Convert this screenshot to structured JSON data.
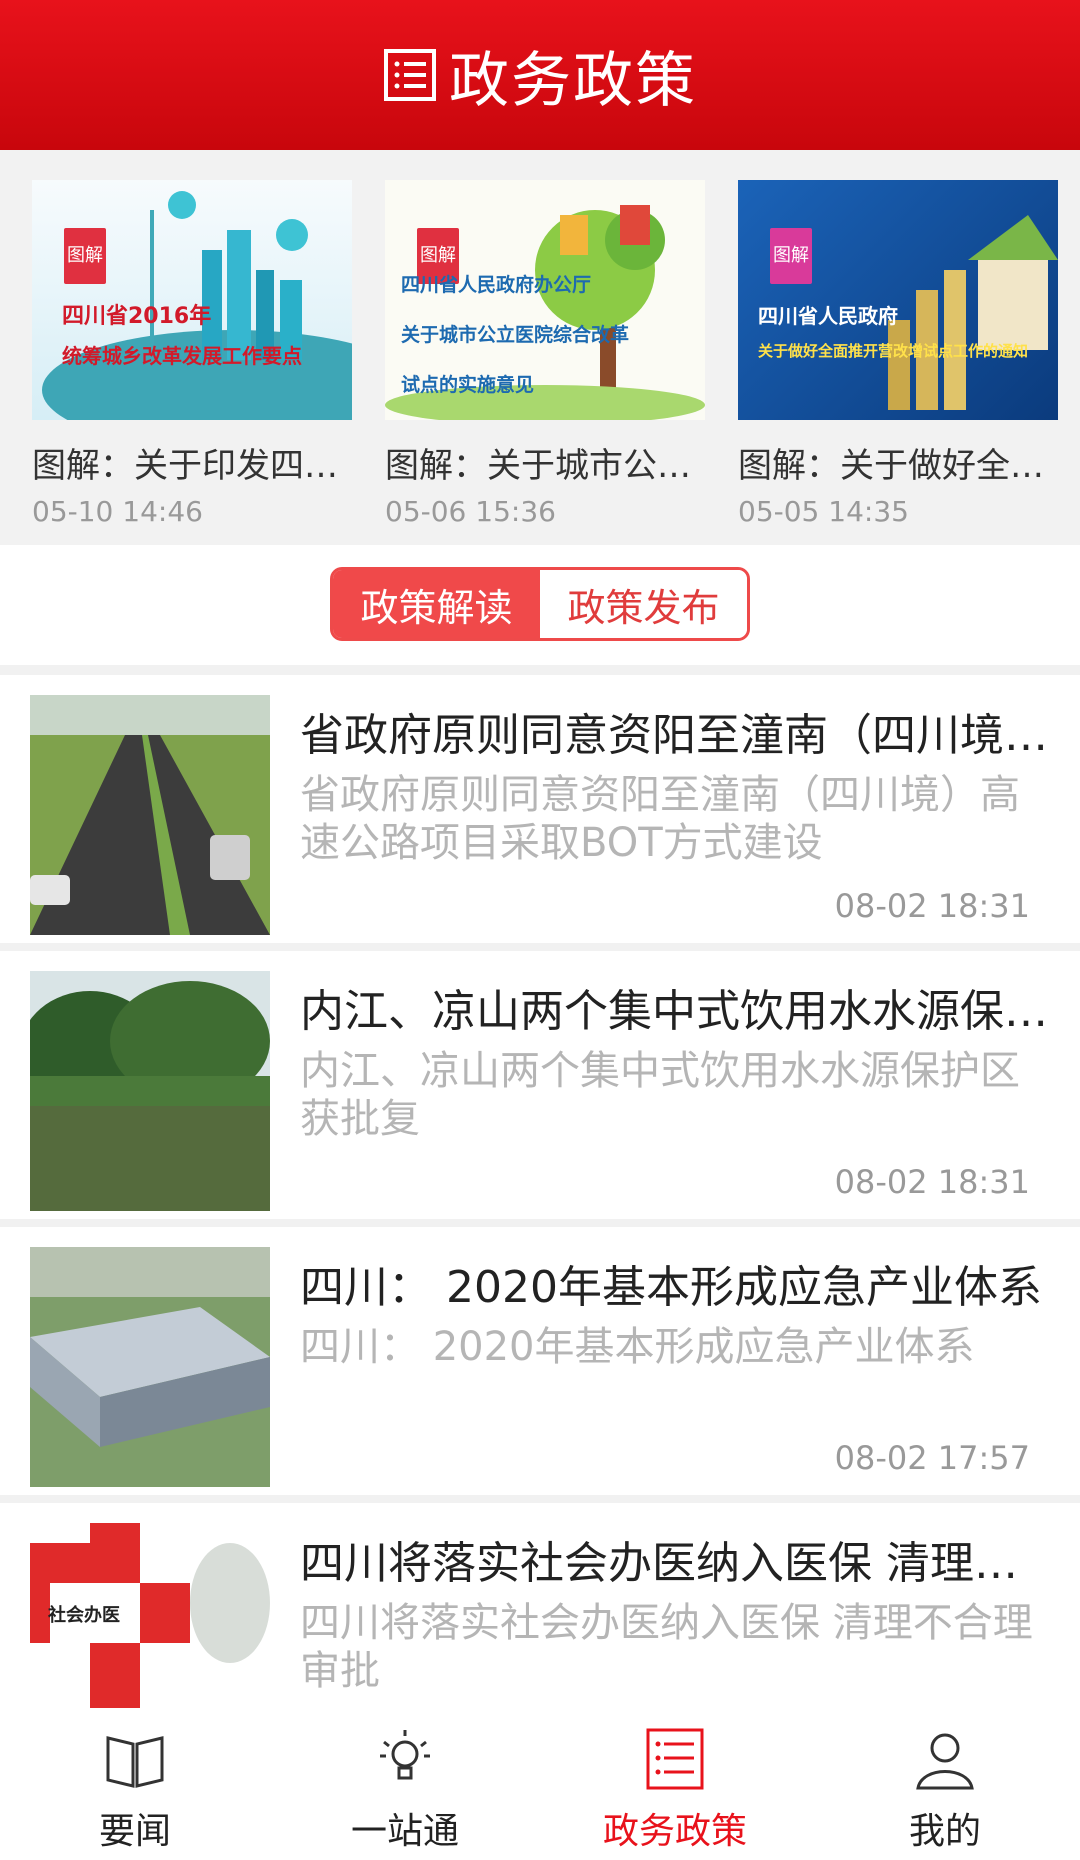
{
  "header": {
    "title": "政务政策",
    "icon": "list-icon"
  },
  "featured": [
    {
      "title": "图解：关于印发四…",
      "time": "05-10 14:46",
      "badge": "图解",
      "thumb_lines": [
        "四川省2016年",
        "统筹城乡改革发展工作要点"
      ]
    },
    {
      "title": "图解：关于城市公…",
      "time": "05-06 15:36",
      "badge": "图解",
      "thumb_lines": [
        "四川省人民政府办公厅",
        "关于城市公立医院综合改革",
        "试点的实施意见"
      ]
    },
    {
      "title": "图解：关于做好全…",
      "time": "05-05 14:35",
      "badge": "图解",
      "thumb_lines": [
        "四川省人民政府",
        "关于做好全面推开营改增试点工作的通知"
      ]
    }
  ],
  "tabs": [
    {
      "label": "政策解读",
      "active": true
    },
    {
      "label": "政策发布",
      "active": false
    }
  ],
  "articles": [
    {
      "title": "省政府原则同意资阳至潼南（四川境…",
      "summary": "省政府原则同意资阳至潼南（四川境）高速公路项目采取BOT方式建设",
      "time": "08-02 18:31"
    },
    {
      "title": "内江、凉山两个集中式饮用水水源保…",
      "summary": "内江、凉山两个集中式饮用水水源保护区获批复",
      "time": "08-02 18:31"
    },
    {
      "title": "四川： 2020年基本形成应急产业体系",
      "summary": "四川： 2020年基本形成应急产业体系",
      "time": "08-02 17:57"
    },
    {
      "title": "四川将落实社会办医纳入医保 清理…",
      "summary": "四川将落实社会办医纳入医保 清理不合理审批",
      "time": "",
      "thumb_text": "社会办医"
    }
  ],
  "nav": [
    {
      "label": "要闻",
      "icon": "book-icon",
      "active": false
    },
    {
      "label": "一站通",
      "icon": "lightbulb-icon",
      "active": false
    },
    {
      "label": "政务政策",
      "icon": "list-icon",
      "active": true
    },
    {
      "label": "我的",
      "icon": "user-icon",
      "active": false
    }
  ],
  "colors": {
    "brand": "#e8121b",
    "tab_active": "#f0494a"
  }
}
